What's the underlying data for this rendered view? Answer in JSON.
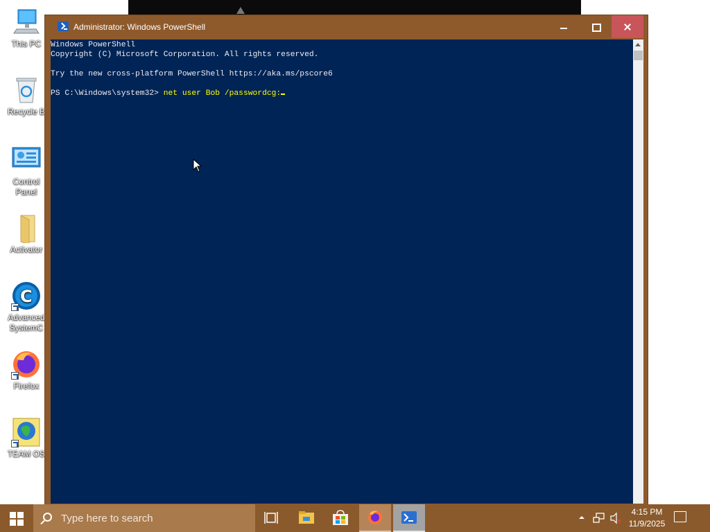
{
  "desktop": {
    "icons": [
      {
        "name": "this-pc",
        "label": "This PC"
      },
      {
        "name": "recycle-bin",
        "label": "Recycle B"
      },
      {
        "name": "control-panel",
        "label": "Control\nPanel"
      },
      {
        "name": "activator",
        "label": "Activator"
      },
      {
        "name": "advanced-systemcare",
        "label": "Advanced\nSystemC"
      },
      {
        "name": "firefox",
        "label": "Firefox"
      },
      {
        "name": "team-os",
        "label": "TEAM OS"
      }
    ]
  },
  "window": {
    "title": "Administrator: Windows PowerShell",
    "icon": "powershell-icon",
    "controls": {
      "minimize": "minimize-icon",
      "maximize": "maximize-icon",
      "close": "close-icon"
    },
    "colors": {
      "titlebar": "#8e5a2c",
      "console_bg": "#012456",
      "close_hover": "#c8555a"
    }
  },
  "console": {
    "lines": [
      "Windows PowerShell",
      "Copyright (C) Microsoft Corporation. All rights reserved.",
      "",
      "Try the new cross-platform PowerShell https://aka.ms/pscore6",
      ""
    ],
    "prompt": "PS C:\\Windows\\system32> ",
    "command_keyword": "net",
    "command_rest": " user Bob /passwordcg:"
  },
  "taskbar": {
    "search_placeholder": "Type here to search",
    "apps": [
      "task-view-icon",
      "file-explorer-icon",
      "microsoft-store-icon",
      "firefox-icon",
      "powershell-icon"
    ],
    "clock": {
      "time": "4:15 PM",
      "date": "11/9/2025"
    },
    "tray_icons": [
      "chevron-up-icon",
      "network-icon",
      "volume-muted-icon",
      "notification-icon"
    ]
  }
}
